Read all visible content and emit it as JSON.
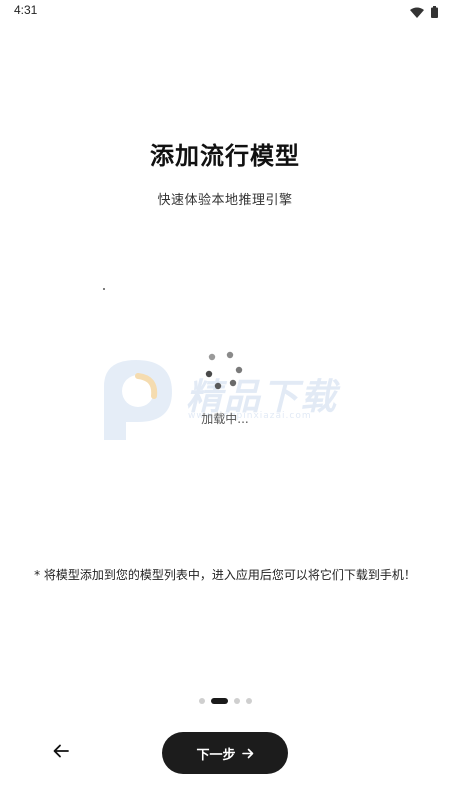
{
  "status_bar": {
    "time": "4:31",
    "icons": [
      "wifi-icon",
      "battery-icon"
    ]
  },
  "header": {
    "title": "添加流行模型",
    "subtitle": "快速体验本地推理引擎"
  },
  "loading": {
    "text": "加载中..."
  },
  "watermark": {
    "text": "精品下载",
    "subtext": "www.jingpinxiazai.com"
  },
  "note": {
    "text": "* 将模型添加到您的模型列表中，进入应用后您可以将它们下载到手机！"
  },
  "pager": {
    "total": 4,
    "active_index": 1
  },
  "footer": {
    "back_icon": "arrow-left-icon",
    "next_label": "下一步",
    "next_icon": "arrow-right-icon"
  },
  "colors": {
    "primary_button": "#1c1c1c",
    "background": "#ffffff",
    "watermark": "#dfe8f5"
  }
}
